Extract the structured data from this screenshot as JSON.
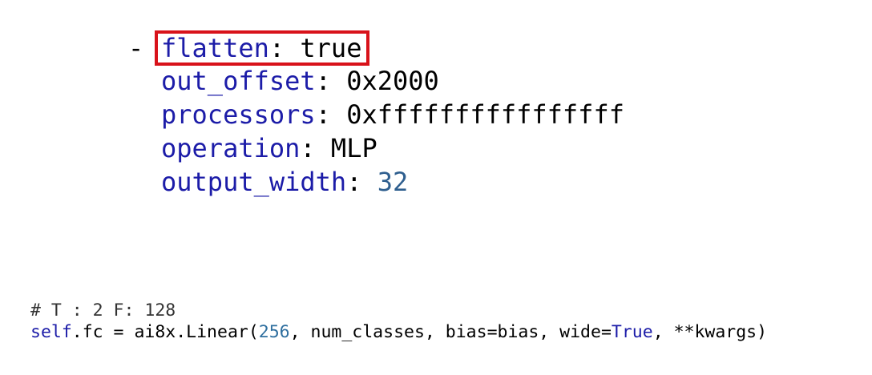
{
  "yaml": {
    "dash": "-",
    "items": [
      {
        "key": "flatten",
        "sep": ": ",
        "value": "true",
        "value_type": "plain"
      },
      {
        "key": "out_offset",
        "sep": ": ",
        "value": "0x2000",
        "value_type": "plain"
      },
      {
        "key": "processors",
        "sep": ": ",
        "value": "0xffffffffffffffff",
        "value_type": "plain"
      },
      {
        "key": "operation",
        "sep": ": ",
        "value": "MLP",
        "value_type": "plain"
      },
      {
        "key": "output_width",
        "sep": ": ",
        "value": "32",
        "value_type": "number"
      }
    ],
    "highlight_color": "#d8121a",
    "key_color": "#1c1ca8"
  },
  "python": {
    "comment": "# T : 2 F: 128",
    "line": {
      "self": "self",
      "part1": ".fc = ai8x.Linear(",
      "num": "256",
      "part2": ", num_classes, bias=bias, wide=",
      "kw": "True",
      "part3": ", **kwargs)"
    }
  }
}
